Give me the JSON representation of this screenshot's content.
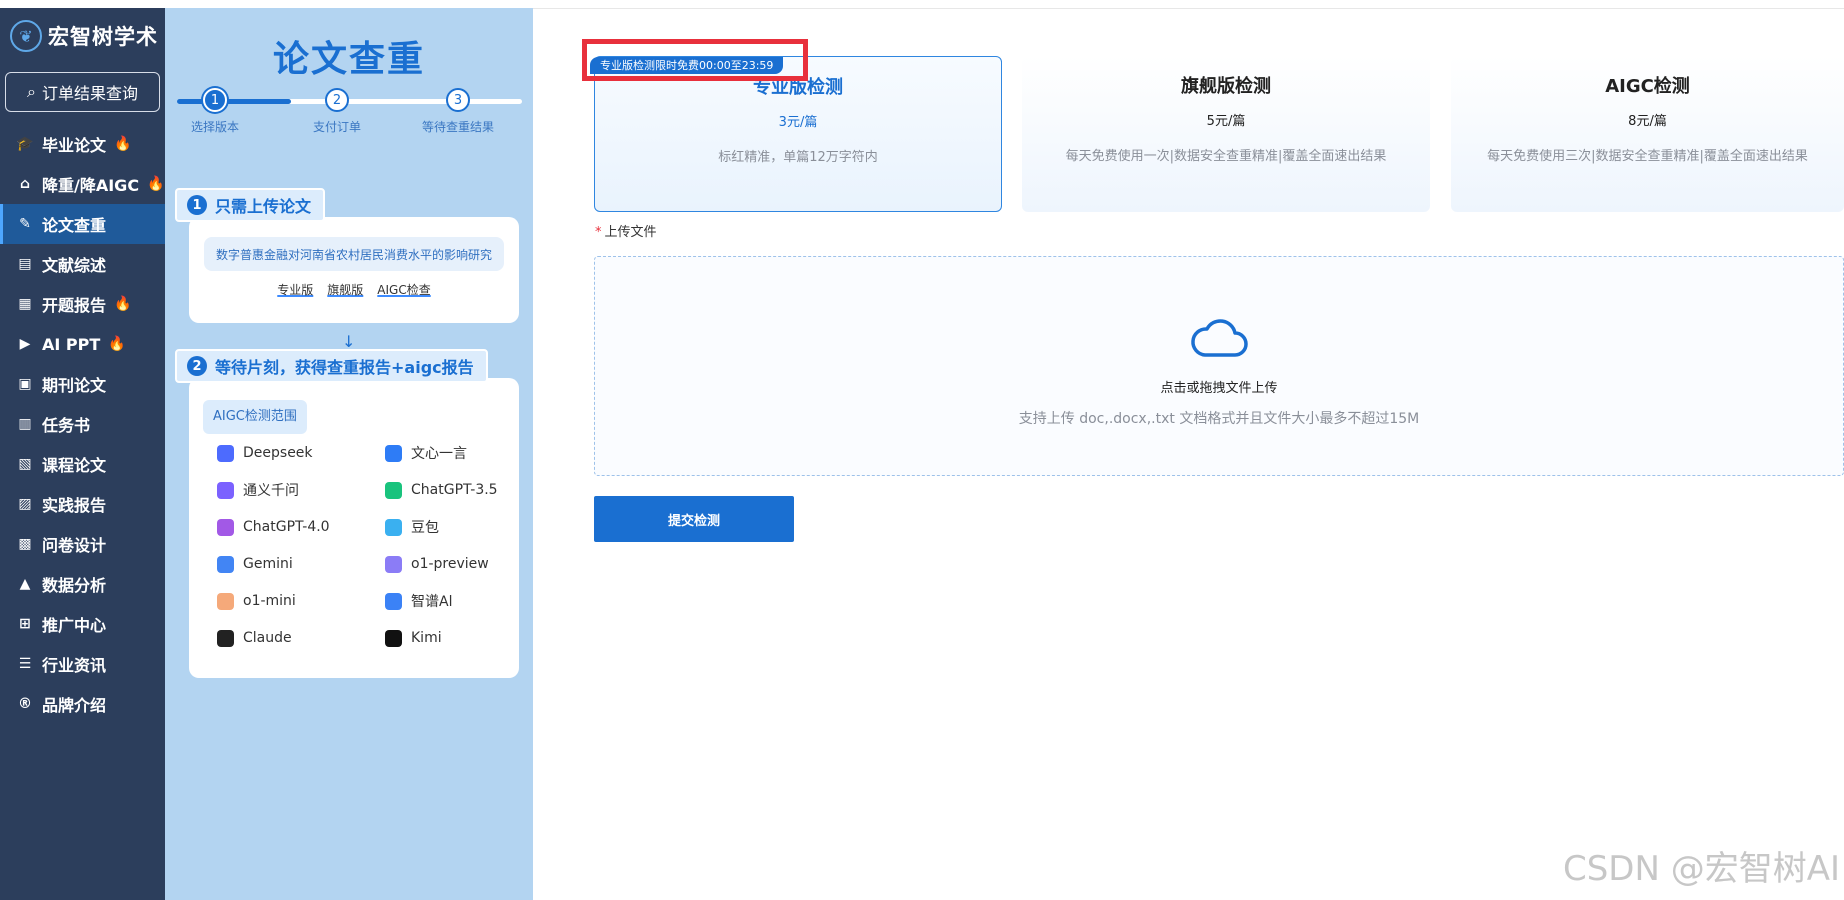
{
  "brand": {
    "name": "宏智树学术"
  },
  "order_button": {
    "label": "订单结果查询"
  },
  "sidebar": {
    "items": [
      {
        "label": "毕业论文",
        "icon": "graduation-cap-icon",
        "hot": true
      },
      {
        "label": "降重/降AIGC",
        "icon": "robot-icon",
        "hot": true
      },
      {
        "label": "论文查重",
        "icon": "document-edit-icon",
        "hot": false,
        "active": true
      },
      {
        "label": "文献综述",
        "icon": "list-card-icon",
        "hot": false
      },
      {
        "label": "开题报告",
        "icon": "report-icon",
        "hot": true
      },
      {
        "label": "AI PPT",
        "icon": "ppt-icon",
        "hot": true
      },
      {
        "label": "期刊论文",
        "icon": "journal-icon",
        "hot": false
      },
      {
        "label": "任务书",
        "icon": "task-book-icon",
        "hot": false
      },
      {
        "label": "课程论文",
        "icon": "course-icon",
        "hot": false
      },
      {
        "label": "实践报告",
        "icon": "practice-icon",
        "hot": false
      },
      {
        "label": "问卷设计",
        "icon": "survey-icon",
        "hot": false
      },
      {
        "label": "数据分析",
        "icon": "chart-icon",
        "hot": false
      },
      {
        "label": "推广中心",
        "icon": "grid-icon",
        "hot": false
      },
      {
        "label": "行业资讯",
        "icon": "news-icon",
        "hot": false
      },
      {
        "label": "品牌介绍",
        "icon": "registered-icon",
        "hot": false
      }
    ]
  },
  "info_panel": {
    "title": "论文查重",
    "steps": [
      {
        "num": "1",
        "label": "选择版本"
      },
      {
        "num": "2",
        "label": "支付订单"
      },
      {
        "num": "3",
        "label": "等待查重结果"
      }
    ],
    "step_progress": 0.33,
    "card1": {
      "num": "1",
      "title": "只需上传论文",
      "topic": "数字普惠金融对河南省农村居民消费水平的影响研究",
      "links": [
        "专业版",
        "旗舰版",
        "AIGC检查"
      ]
    },
    "card2": {
      "num": "2",
      "title": "等待片刻，获得查重报告+aigc报告",
      "tag": "AIGC检测范围",
      "models": [
        {
          "name": "Deepseek",
          "icon": "deepseek-icon",
          "color": "#4d6bfe"
        },
        {
          "name": "文心一言",
          "icon": "wenxin-icon",
          "color": "#2e7cf6"
        },
        {
          "name": "通义千问",
          "icon": "tongyi-icon",
          "color": "#7b61ff"
        },
        {
          "name": "ChatGPT-3.5",
          "icon": "chatgpt35-icon",
          "color": "#19c37d"
        },
        {
          "name": "ChatGPT-4.0",
          "icon": "chatgpt40-icon",
          "color": "#a259e6"
        },
        {
          "name": "豆包",
          "icon": "doubao-icon",
          "color": "#3ab0f0"
        },
        {
          "name": "Gemini",
          "icon": "gemini-icon",
          "color": "#4285f4"
        },
        {
          "name": "o1-preview",
          "icon": "o1-preview-icon",
          "color": "#8b7cf6"
        },
        {
          "name": "o1-mini",
          "icon": "o1-mini-icon",
          "color": "#f5a97a"
        },
        {
          "name": "智谱Al",
          "icon": "zhipu-icon",
          "color": "#3b82f6"
        },
        {
          "name": "Claude",
          "icon": "claude-icon",
          "color": "#222222"
        },
        {
          "name": "Kimi",
          "icon": "kimi-icon",
          "color": "#111111"
        }
      ]
    }
  },
  "plans": [
    {
      "name": "专业版检测",
      "price": "3元/篇",
      "desc": "标红精准，单篇12万字符内",
      "selected": true
    },
    {
      "name": "旗舰版检测",
      "price": "5元/篇",
      "desc": "每天免费使用一次|数据安全查重精准|覆盖全面速出结果",
      "selected": false
    },
    {
      "name": "AIGC检测",
      "price": "8元/篇",
      "desc": "每天免费使用三次|数据安全查重精准|覆盖全面速出结果",
      "selected": false
    }
  ],
  "promo_badge": "专业版检测限时免费00:00至23:59",
  "upload": {
    "required_mark": "*",
    "label": "上传文件",
    "main_text": "点击或拖拽文件上传",
    "hint": "支持上传 doc,.docx,.txt 文档格式并且文件大小最多不超过15M"
  },
  "submit_button": {
    "label": "提交检测"
  },
  "watermark": "CSDN @宏智树AI",
  "colors": {
    "accent": "#1a6fd1",
    "sidebar_bg": "#2c3e5c",
    "panel_bg": "#b3d4f1",
    "highlight": "#e8303c"
  }
}
